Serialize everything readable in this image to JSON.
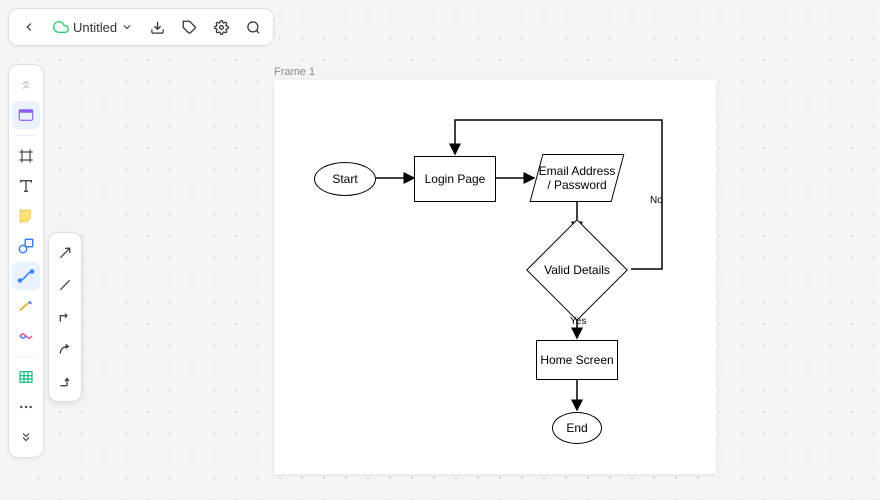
{
  "doc": {
    "title": "Untitled"
  },
  "frame": {
    "label": "Frame 1"
  },
  "nodes": {
    "start": "Start",
    "login": "Login Page",
    "creds": "Email Address / Password",
    "valid": "Valid Details",
    "home": "Home Screen",
    "end": "End"
  },
  "edges": {
    "yes": "Yes",
    "no": "No"
  }
}
